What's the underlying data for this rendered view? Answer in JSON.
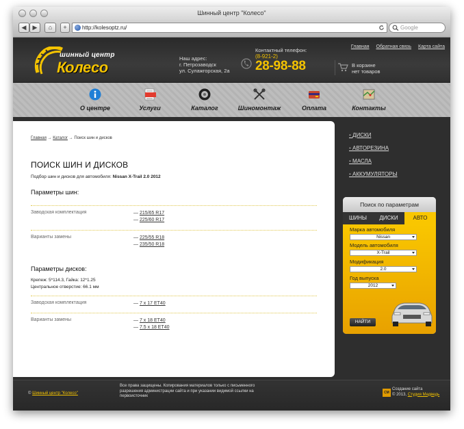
{
  "window": {
    "title": "Шинный центр \"Колесо\"",
    "url": "http://kolesoptz.ru/",
    "search_placeholder": "Google",
    "nav_back": "◀",
    "nav_forward": "▶",
    "home": "⌂",
    "add": "+"
  },
  "header": {
    "logo_sub": "шинный центр",
    "logo_main": "Колесо",
    "address_label": "Наш адрес:",
    "address_city": "г. Петрозаводск",
    "address_street": "ул. Сулажгорская, 2а",
    "phone_label": "Контактный телефон:",
    "phone_code": "(8-921-2)",
    "phone_number": "28-98-88",
    "links": [
      "Главная",
      "Обратная связь",
      "Карта сайта"
    ],
    "cart_line1": "В корзине",
    "cart_line2": "нет товаров"
  },
  "nav": [
    {
      "label": "О центре",
      "icon": "info-icon"
    },
    {
      "label": "Услуги",
      "icon": "document-icon"
    },
    {
      "label": "Каталог",
      "icon": "tire-icon"
    },
    {
      "label": "Шиномонтаж",
      "icon": "tools-icon"
    },
    {
      "label": "Оплата",
      "icon": "wallet-icon"
    },
    {
      "label": "Контакты",
      "icon": "map-icon"
    }
  ],
  "breadcrumb": {
    "home": "Главная",
    "sep": "→",
    "catalog": "Каталог",
    "current": "Поиск шин и дисков"
  },
  "content": {
    "title": "ПОИСК ШИН И ДИСКОВ",
    "subtitle_prefix": "Подбор шин и дисков для автомобиля:",
    "subtitle_car": "Nissan X-Trail 2.0 2012",
    "tires_heading": "Параметры шин:",
    "factory_label": "Заводская комплектация",
    "replace_label": "Варианты замены",
    "tire_factory": [
      "215/65 R17",
      "225/60 R17"
    ],
    "tire_replace": [
      "225/55 R18",
      "235/50 R18"
    ],
    "disks_heading": "Параметры дисков:",
    "disk_info1": "Крепеж: 5*114.3, Гайка: 12*1.25",
    "disk_info2": "Центральное отверстие: 66.1 мм",
    "disk_factory": [
      "7 x 17 ET40"
    ],
    "disk_replace": [
      "7 x 18 ET40",
      "7.5 x 18 ET40"
    ],
    "dash": "—"
  },
  "sidebar": {
    "links": [
      "ДИСКИ",
      "АВТОРЕЗИНА",
      "МАСЛА",
      "АККУМУЛЯТОРЫ"
    ],
    "search_title": "Поиск по параметрам",
    "tabs": [
      "ШИНЫ",
      "ДИСКИ",
      "АВТО"
    ],
    "brand_label": "Марка автомобиля",
    "brand_value": "Nissan",
    "model_label": "Модель автомобиля",
    "model_value": "X-Trail",
    "mod_label": "Модификация",
    "mod_value": "2.0",
    "year_label": "Год выпуска",
    "year_value": "2012",
    "button": "НАЙТИ"
  },
  "footer": {
    "copyright_prefix": "©",
    "copyright_link": "Шинный центр \"Колесо\"",
    "rights_line1": "Все права защищены. Копирования материалов только с письменного",
    "rights_line2": "разрешения администрации сайта и при указании видимой ссылки на",
    "rights_line3": "первоисточник",
    "made_line1": "Создание сайта",
    "made_year": "© 2013,",
    "made_link": "Студия Медведь",
    "studio_icon_text": "СМ"
  },
  "colors": {
    "accent": "#f4c300",
    "dark": "#2e2e2e"
  }
}
